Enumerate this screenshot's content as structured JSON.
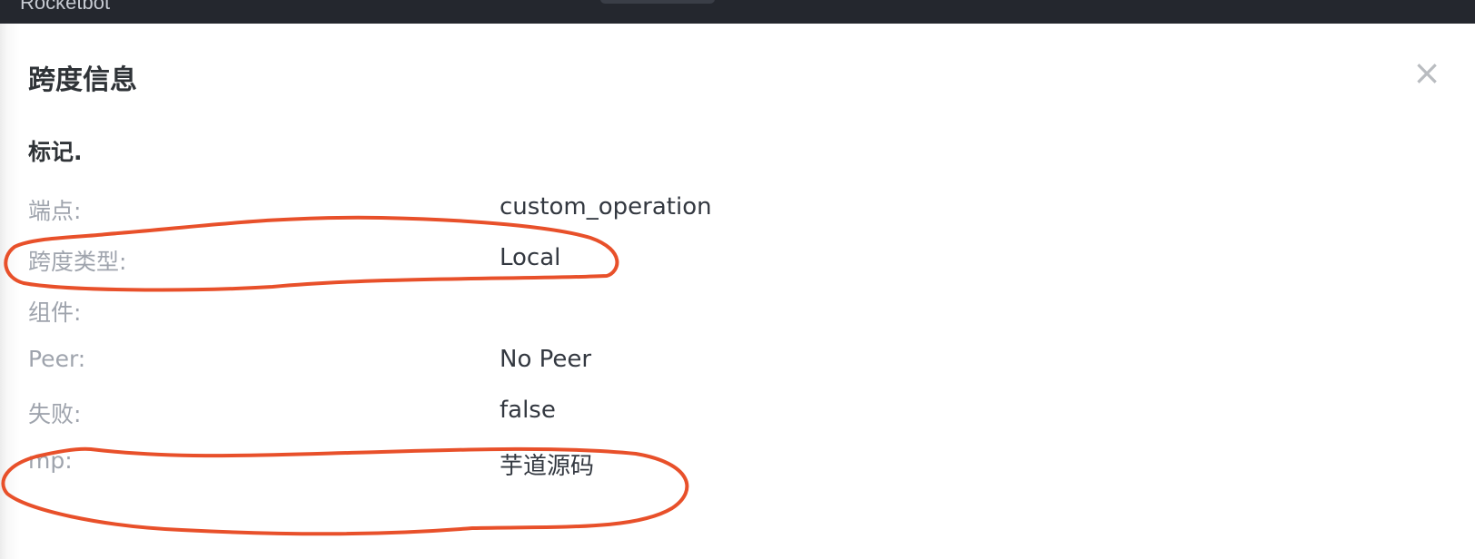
{
  "app": {
    "name": "Rocketbot"
  },
  "modal": {
    "title": "跨度信息",
    "close_label": "×"
  },
  "section": {
    "title": "标记."
  },
  "details": [
    {
      "label": "端点:",
      "value": "custom_operation"
    },
    {
      "label": "跨度类型:",
      "value": "Local"
    },
    {
      "label": "组件:",
      "value": ""
    },
    {
      "label": "Peer:",
      "value": "No Peer"
    },
    {
      "label": "失败:",
      "value": "false"
    },
    {
      "label": "mp:",
      "value": "芋道源码"
    }
  ],
  "colors": {
    "topbar": "#24272e",
    "annotation_stroke": "#e8502a",
    "label_text": "#9fa4ad",
    "value_text": "#333840"
  }
}
